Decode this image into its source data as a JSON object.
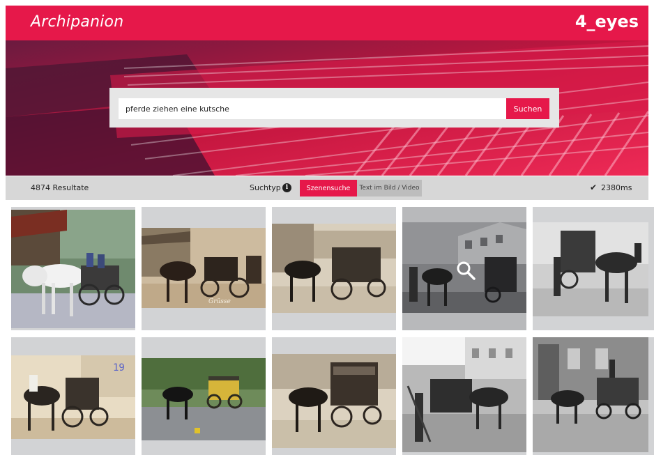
{
  "header": {
    "brand": "Archipanion",
    "tagline": "4_eyes",
    "brand_color": "#e6184a"
  },
  "search": {
    "query": "pferde ziehen eine kutsche",
    "button_label": "Suchen"
  },
  "results_bar": {
    "count_label": "4874 Resultate",
    "search_type_label": "Suchtyp",
    "info_icon": "i",
    "tabs": [
      {
        "label": "Szenensuche",
        "active": true
      },
      {
        "label": "Text im Bild / Video",
        "active": false
      }
    ],
    "check_icon": "✔",
    "timing": "2380ms"
  },
  "results": [
    {
      "icon": "photo-color-white-horses"
    },
    {
      "icon": "photo-sepia-carriage"
    },
    {
      "icon": "photo-sepia-coach"
    },
    {
      "icon": "photo-bw-street-hovered"
    },
    {
      "icon": "photo-bw-horse-cart"
    },
    {
      "icon": "photo-sepia-postcard"
    },
    {
      "icon": "photo-color-yellow-coach"
    },
    {
      "icon": "photo-sepia-covered-wagon"
    },
    {
      "icon": "photo-bw-worker-horse"
    },
    {
      "icon": "photo-bw-loaded-cart"
    }
  ]
}
